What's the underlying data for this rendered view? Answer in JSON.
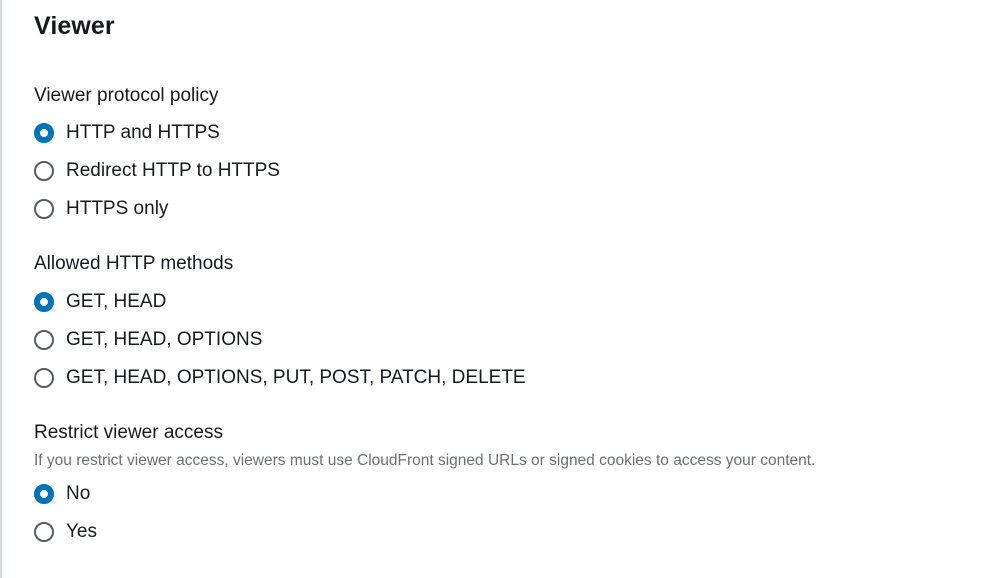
{
  "section": {
    "title": "Viewer"
  },
  "viewer_protocol_policy": {
    "label": "Viewer protocol policy",
    "options": [
      {
        "label": "HTTP and HTTPS",
        "checked": true
      },
      {
        "label": "Redirect HTTP to HTTPS",
        "checked": false
      },
      {
        "label": "HTTPS only",
        "checked": false
      }
    ]
  },
  "allowed_http_methods": {
    "label": "Allowed HTTP methods",
    "options": [
      {
        "label": "GET, HEAD",
        "checked": true
      },
      {
        "label": "GET, HEAD, OPTIONS",
        "checked": false
      },
      {
        "label": "GET, HEAD, OPTIONS, PUT, POST, PATCH, DELETE",
        "checked": false
      }
    ]
  },
  "restrict_viewer_access": {
    "label": "Restrict viewer access",
    "description": "If you restrict viewer access, viewers must use CloudFront signed URLs or signed cookies to access your content.",
    "options": [
      {
        "label": "No",
        "checked": true
      },
      {
        "label": "Yes",
        "checked": false
      }
    ]
  },
  "colors": {
    "accent": "#0073bb",
    "text": "#16191f",
    "muted": "#687078",
    "radio_border": "#545b64"
  }
}
